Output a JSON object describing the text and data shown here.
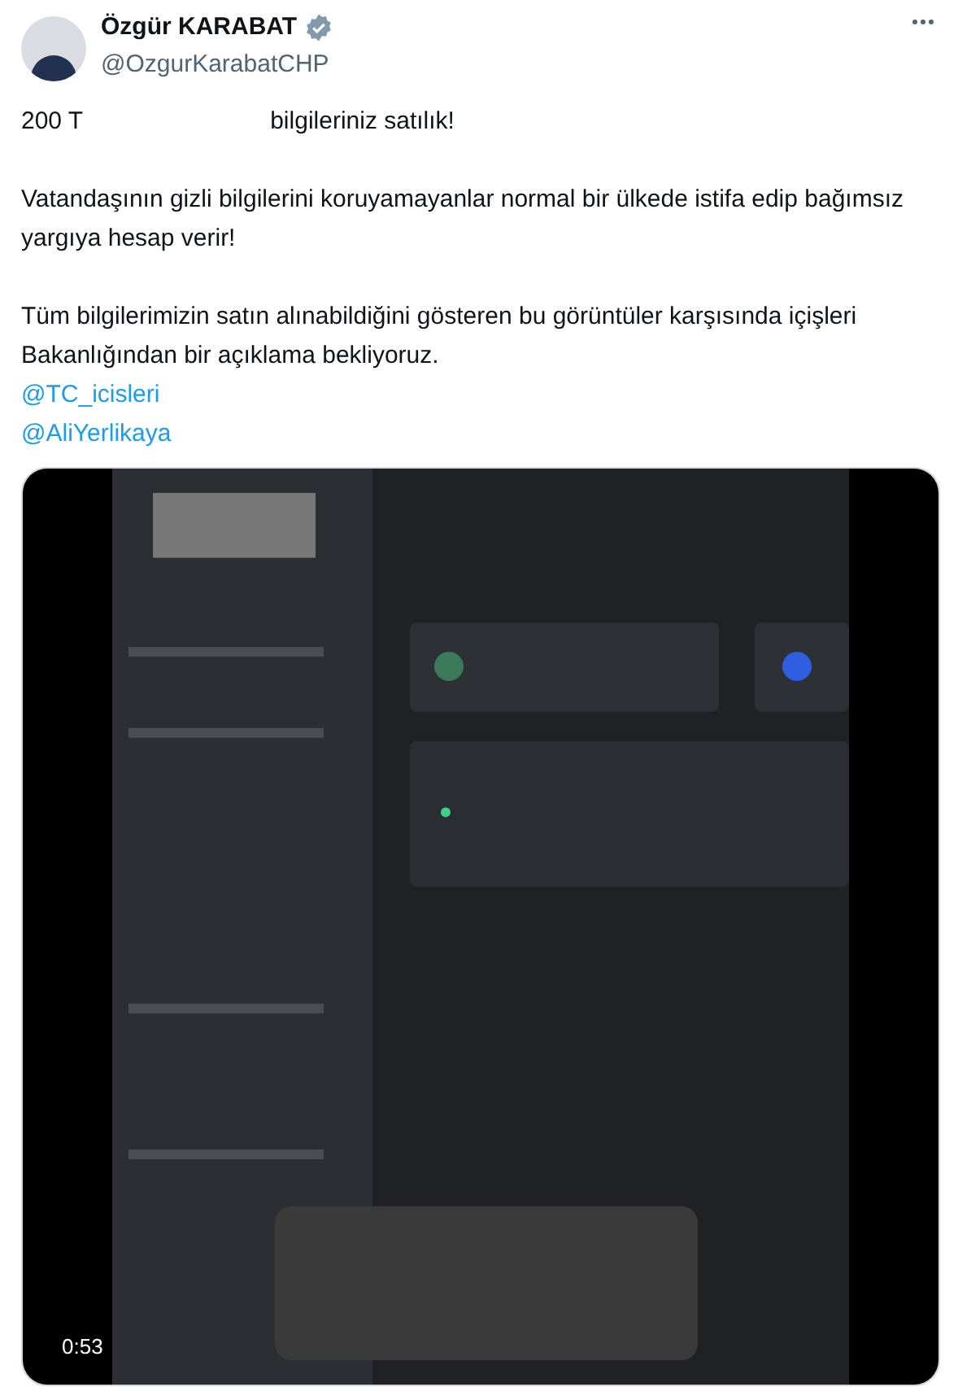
{
  "author": {
    "name": "Özgür KARABAT",
    "verified": true,
    "handle": "@OzgurKarabatCHP"
  },
  "first_line": [
    "200 T",
    "bilgileriniz satılık!"
  ],
  "paragraphs": [
    "Vatandaşının gizli bilgilerini koruyamayanlar normal bir ülkede istifa edip bağımsız yargıya hesap verir!",
    "Tüm bilgilerimizin satın alınabildiğini gösteren bu görüntüler karşısında içişleri Bakanlığından bir açıklama bekliyoruz."
  ],
  "mentions": [
    "@TC_icisleri",
    "@AliYerlikaya"
  ],
  "video": {
    "kind": "picture",
    "duration": "0:53"
  }
}
